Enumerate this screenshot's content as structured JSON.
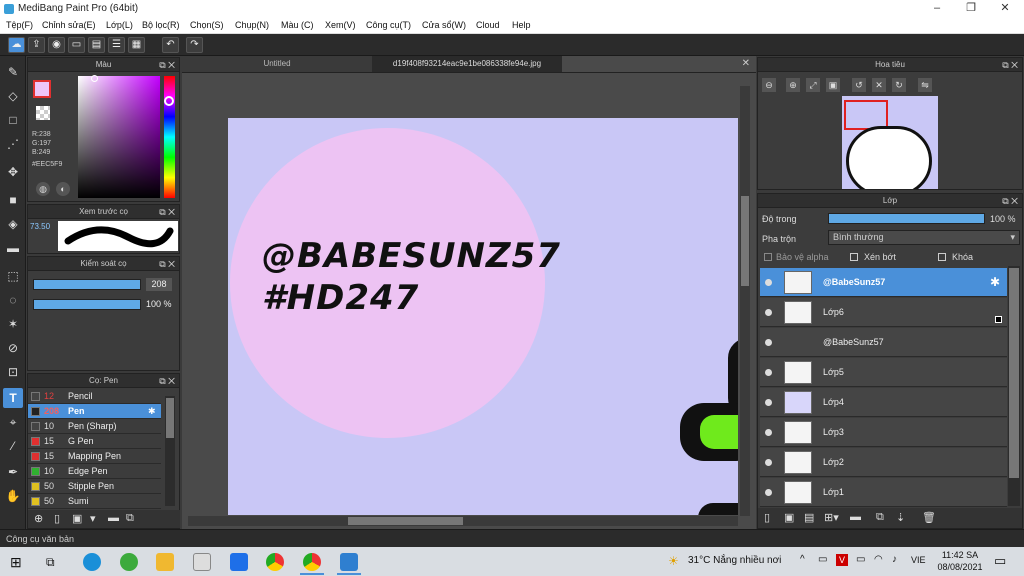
{
  "window": {
    "title": "MediBang Paint Pro (64bit)",
    "minimize": "–",
    "maximize": "❐",
    "close": "✕"
  },
  "menu": [
    "Tệp(F)",
    "Chỉnh sửa(E)",
    "Lớp(L)",
    "Bộ lọc(R)",
    "Chọn(S)",
    "Chụp(N)",
    "Màu (C)",
    "Xem(V)",
    "Công cụ(T)",
    "Cửa sổ(W)",
    "Cloud",
    "Help"
  ],
  "color_panel": {
    "title": "Màu",
    "r": "R:238",
    "g": "G:197",
    "b": "B:249",
    "hex": "#EEC5F9",
    "accent": "#EEC5F9"
  },
  "preview_panel": {
    "title": "Xem trước cọ",
    "size": "73.50"
  },
  "brush_control": {
    "title": "Kiểm soát cọ",
    "size_value": "208",
    "opacity_value": "100 %"
  },
  "brush_panel": {
    "title": "Cọ: Pen",
    "brushes": [
      {
        "size": "12",
        "name": "Pencil",
        "color": "#444444"
      },
      {
        "size": "208",
        "name": "Pen",
        "color": "#222222",
        "selected": true
      },
      {
        "size": "10",
        "name": "Pen (Sharp)",
        "color": "#444444"
      },
      {
        "size": "15",
        "name": "G Pen",
        "color": "#e03030"
      },
      {
        "size": "15",
        "name": "Mapping Pen",
        "color": "#e03030"
      },
      {
        "size": "10",
        "name": "Edge Pen",
        "color": "#30b030"
      },
      {
        "size": "50",
        "name": "Stipple Pen",
        "color": "#e0c020"
      },
      {
        "size": "50",
        "name": "Sumi",
        "color": "#e0c020"
      }
    ]
  },
  "tabs": {
    "untitled": "Untitled",
    "file": "d19f408f93214eac9e1be086338fe94e.jpg"
  },
  "canvas": {
    "line1": "@BABESUNZ57",
    "line2": "#HD247"
  },
  "navigator": {
    "title": "Hoa tiêu"
  },
  "layers_panel": {
    "title": "Lớp",
    "opacity_label": "Độ trong",
    "opacity_value": "100 %",
    "blend_label": "Pha trộn",
    "blend_value": "Bình thường",
    "protect_alpha": "Bảo vệ alpha",
    "clipping": "Xén bớt",
    "lock": "Khóa",
    "layers": [
      {
        "name": "@BabeSunz57",
        "selected": true
      },
      {
        "name": "Lớp6"
      },
      {
        "name": "@BabeSunz57"
      },
      {
        "name": "Lớp5"
      },
      {
        "name": "Lớp4"
      },
      {
        "name": "Lớp3"
      },
      {
        "name": "Lớp2"
      },
      {
        "name": "Lớp1"
      }
    ]
  },
  "status": {
    "text": "Công cụ văn bản"
  },
  "taskbar": {
    "weather": "31°C  Nắng nhiều nơi",
    "lang": "VIE",
    "time": "11:42 SA",
    "date": "08/08/2021"
  }
}
